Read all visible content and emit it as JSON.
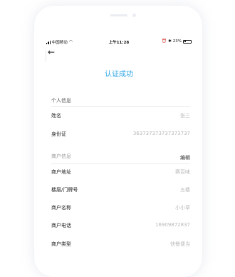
{
  "status_bar": {
    "carrier": "中国移动",
    "time": "上午11:28",
    "battery": "23%",
    "battery_level": 0.23
  },
  "title": "认证成功",
  "personal": {
    "header": "个人信息",
    "rows": [
      {
        "label": "姓名",
        "value": "张三"
      },
      {
        "label": "身份证",
        "value": "363737373737373737"
      }
    ]
  },
  "merchant": {
    "header": "商户信息",
    "edit_label": "编辑",
    "rows": [
      {
        "label": "商户地址",
        "value": "赛百味"
      },
      {
        "label": "楼层/门牌号",
        "value": "五楼"
      },
      {
        "label": "商户名称",
        "value": "小小草"
      },
      {
        "label": "商户电话",
        "value": "16909872837"
      },
      {
        "label": "商户类型",
        "value": "快餐便当"
      }
    ]
  },
  "colors": {
    "accent": "#2aa3e6",
    "value_text": "#b9b9b9"
  },
  "icons": {
    "back": "arrow-left-icon",
    "wifi": "wifi-icon",
    "bluetooth": "bluetooth-icon",
    "alarm": "alarm-icon"
  }
}
